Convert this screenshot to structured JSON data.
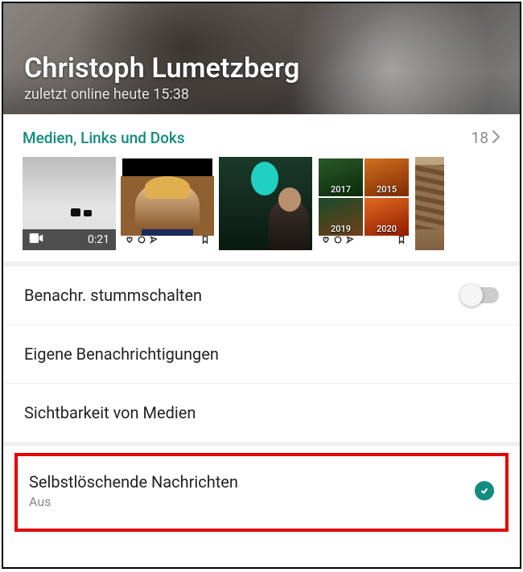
{
  "header": {
    "name": "Christoph Lumetzberg",
    "status": "zuletzt online heute 15:38"
  },
  "media": {
    "title": "Medien, Links und Doks",
    "count": "18",
    "thumb1_duration": "0:21",
    "thumb4": {
      "a": "2017",
      "b": "2015",
      "c": "2019",
      "d": "2020"
    }
  },
  "settings": {
    "mute": "Benachr. stummschalten",
    "custom_notifications": "Eigene Benachrichtigungen",
    "media_visibility": "Sichtbarkeit von Medien",
    "disappearing": {
      "title": "Selbstlöschende Nachrichten",
      "value": "Aus"
    }
  },
  "colors": {
    "accent": "#128C7E",
    "highlight": "#e40202"
  }
}
